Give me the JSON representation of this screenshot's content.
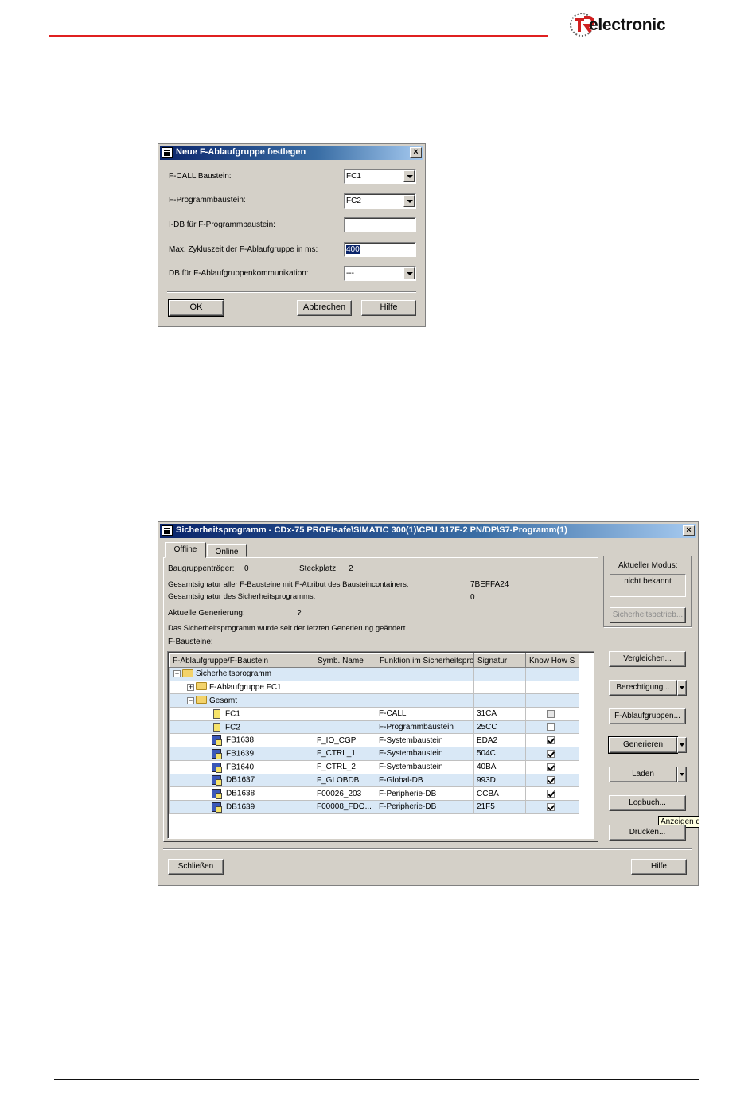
{
  "brand": {
    "logo_text": "electronic",
    "logo_initial": "TR"
  },
  "dialog1": {
    "title": "Neue F-Ablaufgruppe festlegen",
    "labels": {
      "fcall": "F-CALL Baustein:",
      "fprog": "F-Programmbaustein:",
      "idb": "I-DB für F-Programmbaustein:",
      "maxzyk": "Max. Zykluszeit der F-Ablaufgruppe in ms:",
      "dbkomm": "DB für F-Ablaufgruppenkommunikation:"
    },
    "values": {
      "fcall": "FC1",
      "fprog": "FC2",
      "idb": "",
      "maxzyk": "400",
      "dbkomm": "---"
    },
    "buttons": {
      "ok": "OK",
      "abbrechen": "Abbrechen",
      "hilfe": "Hilfe"
    }
  },
  "dialog2": {
    "title": "Sicherheitsprogramm - CDx-75 PROFIsafe\\SIMATIC 300(1)\\CPU 317F-2 PN/DP\\S7-Programm(1)",
    "tabs": [
      "Offline",
      "Online"
    ],
    "info": {
      "baugruppentraeger_label": "Baugruppenträger:",
      "baugruppentraeger_value": "0",
      "steckplatz_label": "Steckplatz:",
      "steckplatz_value": "2",
      "gesamt_bausteine_label": "Gesamtsignatur aller F-Bausteine mit F-Attribut des Bausteincontainers:",
      "gesamt_bausteine_value": "7BEFFA24",
      "gesamt_prog_label": "Gesamtsignatur des Sicherheitsprogramms:",
      "gesamt_prog_value": "0",
      "aktuelle_gen_label": "Aktuelle Generierung:",
      "aktuelle_gen_value": "?",
      "status_text": "Das Sicherheitsprogramm wurde seit der letzten Generierung geändert.",
      "fbausteine_label": "F-Bausteine:"
    },
    "modus": {
      "label": "Aktueller Modus:",
      "value": "nicht bekannt",
      "button": "Sicherheitsbetrieb..."
    },
    "table": {
      "headers": [
        "F-Ablaufgruppe/F-Baustein",
        "Symb. Name",
        "Funktion im Sicherheitspro",
        "Signatur",
        "Know How S"
      ],
      "rows": [
        {
          "name": "Sicherheitsprogramm",
          "symb": "",
          "funk": "",
          "sig": "",
          "kh": ""
        },
        {
          "name": "F-Ablaufgruppe FC1",
          "symb": "",
          "funk": "",
          "sig": "",
          "kh": ""
        },
        {
          "name": "Gesamt",
          "symb": "",
          "funk": "",
          "sig": "",
          "kh": ""
        },
        {
          "name": "FC1",
          "symb": "",
          "funk": "F-CALL",
          "sig": "31CA",
          "kh": "grey"
        },
        {
          "name": "FC2",
          "symb": "",
          "funk": "F-Programmbaustein",
          "sig": "25CC",
          "kh": "off"
        },
        {
          "name": "FB1638",
          "symb": "F_IO_CGP",
          "funk": "F-Systembaustein",
          "sig": "EDA2",
          "kh": "on"
        },
        {
          "name": "FB1639",
          "symb": "F_CTRL_1",
          "funk": "F-Systembaustein",
          "sig": "504C",
          "kh": "on"
        },
        {
          "name": "FB1640",
          "symb": "F_CTRL_2",
          "funk": "F-Systembaustein",
          "sig": "40BA",
          "kh": "on"
        },
        {
          "name": "DB1637",
          "symb": "F_GLOBDB",
          "funk": "F-Global-DB",
          "sig": "993D",
          "kh": "on"
        },
        {
          "name": "DB1638",
          "symb": "F00026_203",
          "funk": "F-Peripherie-DB",
          "sig": "CCBA",
          "kh": "on"
        },
        {
          "name": "DB1639",
          "symb": "F00008_FDO...",
          "funk": "F-Peripherie-DB",
          "sig": "21F5",
          "kh": "on"
        }
      ]
    },
    "side_buttons": {
      "vergleichen": "Vergleichen...",
      "berechtigung": "Berechtigung...",
      "ablaufgruppen": "F-Ablaufgruppen...",
      "generieren": "Generieren",
      "laden": "Laden",
      "logbuch": "Logbuch...",
      "drucken": "Drucken..."
    },
    "tooltip": "Anzeigen d",
    "bottom_buttons": {
      "schliessen": "Schließen",
      "hilfe": "Hilfe"
    }
  }
}
